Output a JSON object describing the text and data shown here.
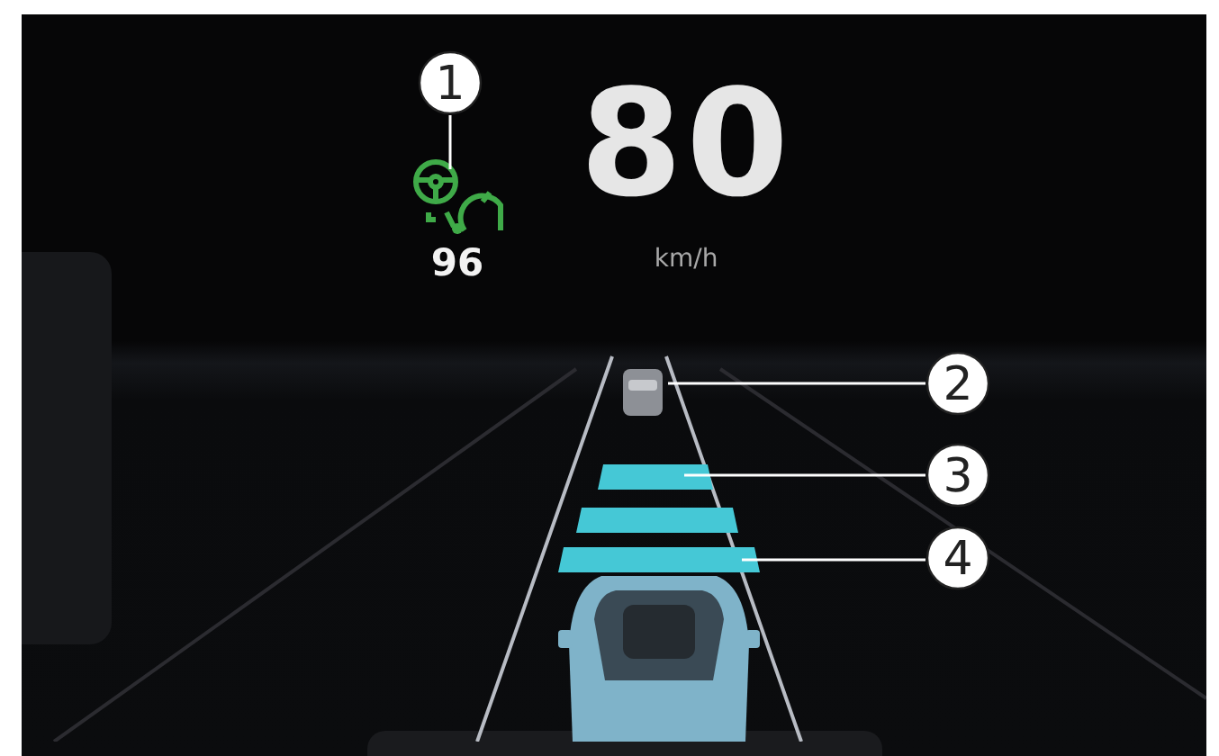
{
  "cruise": {
    "set_speed": "96"
  },
  "speed": {
    "value": "80",
    "unit": "km/h"
  },
  "distance_bars": [
    {
      "lit": true
    },
    {
      "lit": true
    },
    {
      "lit": true
    }
  ],
  "callouts": [
    {
      "label": "1"
    },
    {
      "label": "2"
    },
    {
      "label": "3"
    },
    {
      "label": "4"
    }
  ]
}
